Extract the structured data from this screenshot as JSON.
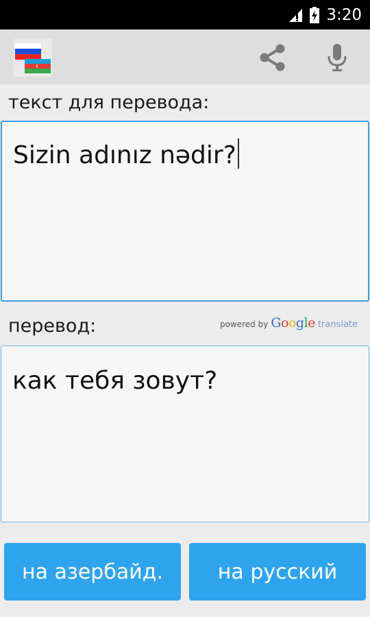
{
  "status_bar": {
    "time": "3:20",
    "icons": [
      "signal-icon",
      "battery-charging-icon"
    ]
  },
  "action_bar": {
    "app_icon": "flags-ru-az-icon",
    "actions": [
      {
        "name": "share-icon"
      },
      {
        "name": "microphone-icon"
      }
    ]
  },
  "source": {
    "label": "текст для перевода:",
    "text": "Sizin adınız nədir?"
  },
  "result": {
    "label": "перевод:",
    "text": "как тебя зовут?"
  },
  "attribution": {
    "powered_by": "powered by",
    "logo_letters": [
      "G",
      "o",
      "o",
      "g",
      "l",
      "e"
    ],
    "translate": "translate"
  },
  "buttons": {
    "to_azerbaijani": "на азербайд.",
    "to_russian": "на русский"
  },
  "colors": {
    "accent": "#2ea4ee",
    "border": "#39a0e6",
    "action_bar": "#dedede"
  }
}
